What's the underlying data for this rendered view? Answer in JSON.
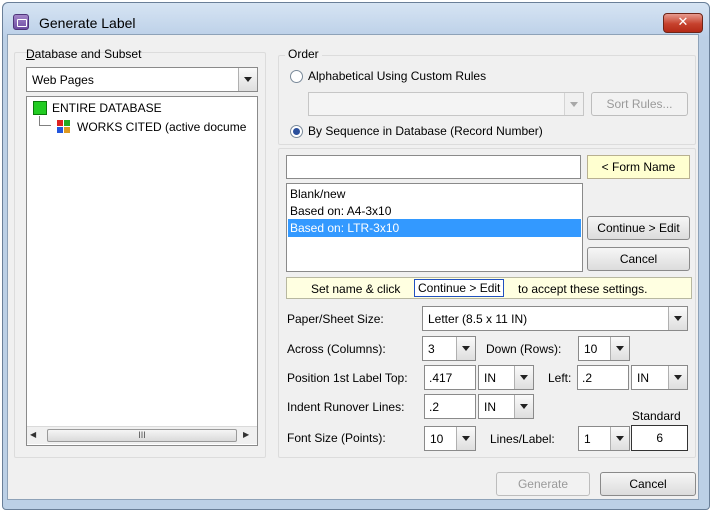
{
  "window": {
    "title": "Generate Label",
    "close_label": "✕"
  },
  "database_subset": {
    "group_label": "Database and Subset",
    "selected": "Web Pages",
    "tree": [
      {
        "label": "ENTIRE DATABASE",
        "icon": "green-square-icon"
      },
      {
        "label": "WORKS CITED (active docume",
        "icon": "colored-grid-icon"
      }
    ],
    "hscroll_thumb_label": "III",
    "left_arrow": "◀",
    "right_arrow": "▶"
  },
  "order": {
    "group_label": "Order",
    "alphabetical_label": "Alphabetical Using Custom Rules",
    "alphabetical_checked": false,
    "custom_rules_value": "",
    "sort_rules_label": "Sort Rules...",
    "sequence_label": "By Sequence in Database (Record Number)",
    "sequence_checked": true
  },
  "form": {
    "name_value": "",
    "form_name_label": "< Form Name",
    "list": [
      "Blank/new",
      "Based on: A4-3x10",
      "Based on: LTR-3x10"
    ],
    "selected_index": 2,
    "continue_label": "Continue > Edit",
    "cancel_label": "Cancel",
    "hint_before": "Set name & click",
    "hint_button": "Continue > Edit",
    "hint_after": "to accept these settings."
  },
  "settings": {
    "paper_label": "Paper/Sheet Size:",
    "paper_value": "Letter (8.5 x 11 IN)",
    "across_label": "Across (Columns):",
    "across_value": "3",
    "down_label": "Down (Rows):",
    "down_value": "10",
    "position_label": "Position 1st Label Top:",
    "top_value": ".417",
    "top_unit": "IN",
    "left_label": "Left:",
    "left_value": ".2",
    "left_unit": "IN",
    "indent_label": "Indent Runover Lines:",
    "indent_value": ".2",
    "indent_unit": "IN",
    "font_label": "Font Size (Points):",
    "font_value": "10",
    "lines_label": "Lines/Label:",
    "lines_value": "1",
    "standard_label": "Standard",
    "standard_value": "6"
  },
  "footer": {
    "generate_label": "Generate",
    "cancel_label": "Cancel"
  }
}
